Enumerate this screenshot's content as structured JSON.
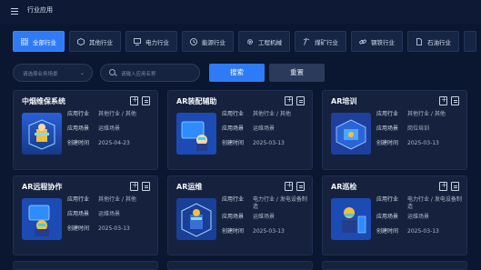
{
  "header": {
    "title": "行业应用"
  },
  "tabs": [
    {
      "label": "全部行业",
      "icon": "grid-icon",
      "active": true
    },
    {
      "label": "其他行业",
      "icon": "cube-icon",
      "active": false
    },
    {
      "label": "电力行业",
      "icon": "monitor-icon",
      "active": false
    },
    {
      "label": "能源行业",
      "icon": "clock-icon",
      "active": false
    },
    {
      "label": "工程机械",
      "icon": "gear-icon",
      "active": false
    },
    {
      "label": "煤矿行业",
      "icon": "pickaxe-icon",
      "active": false
    },
    {
      "label": "钢铁行业",
      "icon": "link-icon",
      "active": false
    },
    {
      "label": "石油行业",
      "icon": "document-icon",
      "active": false
    }
  ],
  "filters": {
    "scene_placeholder": "请选择业务场景",
    "search_placeholder": "请输入应用名称",
    "search_label": "搜索",
    "reset_label": "重置"
  },
  "labels": {
    "industry": "应用行业",
    "scene": "应用场景",
    "created": "创建时间"
  },
  "colors": {
    "accent": "#2f7bf6",
    "background": "#0b1630",
    "card": "#16223d"
  },
  "cards": [
    {
      "title": "中烟维保系统",
      "industry": "其他行业 / 其他",
      "scene": "运维场景",
      "created": "2025-04-23"
    },
    {
      "title": "AR装配辅助",
      "industry": "其他行业 / 其他",
      "scene": "运维场景",
      "created": "2025-03-13"
    },
    {
      "title": "AR培训",
      "industry": "其他行业 / 其他",
      "scene": "岗位培训",
      "created": "2025-03-13"
    },
    {
      "title": "AR远程协作",
      "industry": "其他行业 / 其他",
      "scene": "运维场景",
      "created": "2025-03-13"
    },
    {
      "title": "AR运维",
      "industry": "电力行业 / 发电设备制造",
      "scene": "运维场景",
      "created": "2025-03-13"
    },
    {
      "title": "AR巡检",
      "industry": "电力行业 / 发电设备制造",
      "scene": "运维场景",
      "created": "2025-03-13"
    }
  ]
}
